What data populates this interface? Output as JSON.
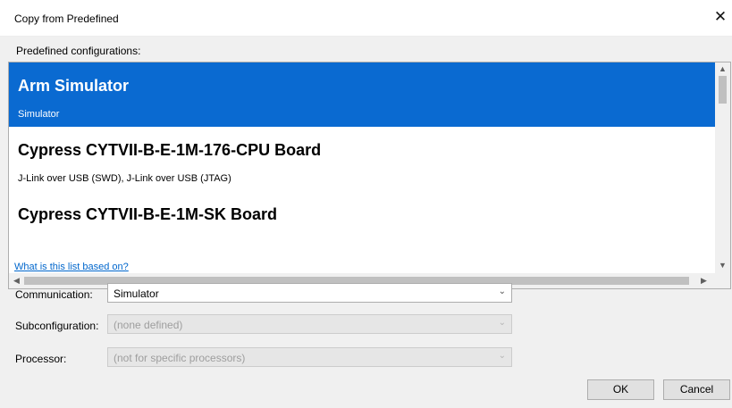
{
  "window": {
    "title": "Copy from Predefined",
    "close_symbol": "✕"
  },
  "list": {
    "label": "Predefined configurations:",
    "items": [
      {
        "title": "Arm Simulator",
        "subtitle": "Simulator",
        "selected": true
      },
      {
        "title": "Cypress CYTVII-B-E-1M-176-CPU Board",
        "subtitle": "J-Link over USB (SWD), J-Link over USB (JTAG)",
        "selected": false
      },
      {
        "title": "Cypress CYTVII-B-E-1M-SK Board",
        "subtitle": "",
        "selected": false
      }
    ],
    "scroll_up": "▲",
    "scroll_down": "▼",
    "scroll_left": "◀",
    "scroll_right": "▶"
  },
  "help_link": "What is this list based on?",
  "fields": {
    "communication": {
      "label": "Communication:",
      "value": "Simulator",
      "enabled": true
    },
    "subconfiguration": {
      "label": "Subconfiguration:",
      "value": "(none defined)",
      "enabled": false
    },
    "processor": {
      "label": "Processor:",
      "value": "(not for specific processors)",
      "enabled": false
    }
  },
  "combo_arrow": "⌄",
  "buttons": {
    "ok": "OK",
    "cancel": "Cancel"
  },
  "colors": {
    "selection": "#0a6ad1",
    "link": "#0066cc"
  },
  "icons": {
    "close": "close-icon",
    "dropdown": "chevron-down-icon"
  }
}
